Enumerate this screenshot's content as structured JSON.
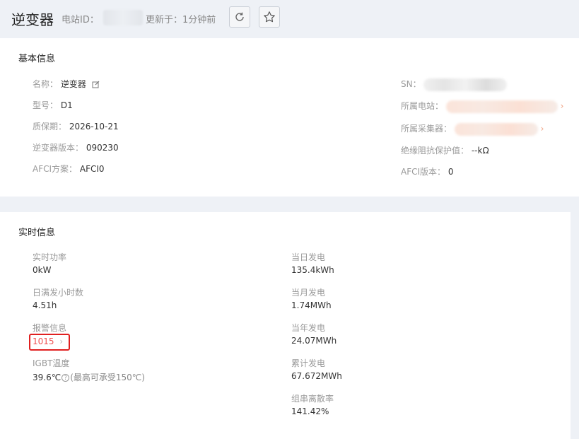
{
  "header": {
    "title": "逆变器",
    "station_id_label": "电站ID：",
    "updated_label": "更新于：1分钟前",
    "refresh_icon": "refresh-icon",
    "star_icon": "star-icon"
  },
  "basic": {
    "title": "基本信息",
    "name_label": "名称：",
    "name_value": "逆变器",
    "model_label": "型号：",
    "model_value": "D1",
    "warranty_label": "质保期：",
    "warranty_value": "2026-10-21",
    "version_label": "逆变器版本：",
    "version_value": "090230",
    "afci_label": "AFCI方案：",
    "afci_value": "AFCI0",
    "sn_label": "SN：",
    "station_label": "所属电站：",
    "collector_label": "所属采集器：",
    "insulation_label": "绝缘阻抗保护值：",
    "insulation_value": "--kΩ",
    "afci_version_label": "AFCI版本：",
    "afci_version_value": "0"
  },
  "realtime": {
    "title": "实时信息",
    "power_label": "实时功率",
    "power_value": "0kW",
    "hours_label": "日满发小时数",
    "hours_value": "4.51h",
    "alarm_label": "报警信息",
    "alarm_value": "1015",
    "igbt_label": "IGBT温度",
    "igbt_value": "39.6℃",
    "igbt_note": "(最高可承受150℃)",
    "day_label": "当日发电",
    "day_value": "135.4kWh",
    "month_label": "当月发电",
    "month_value": "1.74MWh",
    "year_label": "当年发电",
    "year_value": "24.07MWh",
    "total_label": "累计发电",
    "total_value": "67.672MWh",
    "dispersion_label": "组串离散率",
    "dispersion_value": "141.42%"
  }
}
